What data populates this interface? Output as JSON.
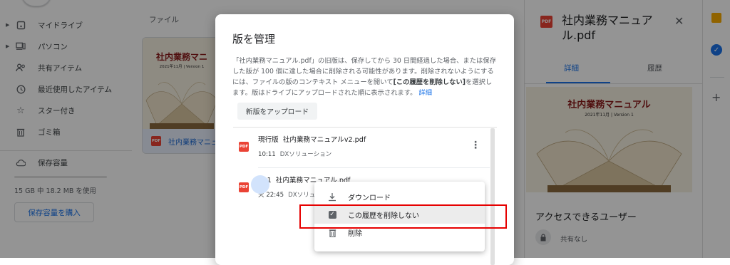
{
  "sidebar": {
    "items": [
      {
        "label": "マイドライブ",
        "icon": "drive-icon",
        "expandable": true
      },
      {
        "label": "パソコン",
        "icon": "computer-icon",
        "expandable": true
      },
      {
        "label": "共有アイテム",
        "icon": "shared-icon",
        "expandable": false
      },
      {
        "label": "最近使用したアイテム",
        "icon": "clock-icon",
        "expandable": false
      },
      {
        "label": "スター付き",
        "icon": "star-icon",
        "expandable": false
      },
      {
        "label": "ゴミ箱",
        "icon": "trash-icon",
        "expandable": false
      }
    ],
    "storage_label": "保存容量",
    "storage_usage": "15 GB 中 18.2 MB を使用",
    "buy_storage": "保存容量を購入"
  },
  "main": {
    "column_header": "ファイル",
    "file_name": "社内業務マニュ",
    "thumb_title": "社内業務マニ",
    "thumb_sub": "2021年11月 | Version 1"
  },
  "details_panel": {
    "title": "社内業務マニュアル.pdf",
    "tabs": [
      "詳細",
      "履歴"
    ],
    "thumb_title": "社内業務マニュアル",
    "thumb_sub": "2021年11月 | Version 1",
    "access_title": "アクセスできるユーザー",
    "access_status": "共有なし"
  },
  "dialog": {
    "title": "版を管理",
    "desc_1": "「社内業務マニュアル.pdf」の旧版は、保存してから 30 日間経過した場合、または保存した版が 100 個に達した場合に削除される可能性があります。削除されないようにするには、ファイルの版のコンテキスト メニューを開いて",
    "desc_bold": "[この履歴を削除しない]",
    "desc_2": "を選択します。版はドライブにアップロードされた順に表示されます。",
    "desc_link": "詳細",
    "upload_button": "新版をアップロード",
    "versions": [
      {
        "tag": "現行版",
        "name": "社内業務マニュアルv2.pdf",
        "time": "10:11",
        "owner": "DXソリューション"
      },
      {
        "tag": "版 1",
        "name": "社内業務マニュアル.pdf",
        "time": "火 22:45",
        "owner": "DXソリュー"
      }
    ]
  },
  "context_menu": {
    "items": [
      {
        "label": "ダウンロード",
        "icon": "download-icon"
      },
      {
        "label": "この履歴を削除しない",
        "icon": "checkbox-checked-icon",
        "highlighted": true
      },
      {
        "label": "削除",
        "icon": "trash-icon"
      }
    ]
  },
  "colors": {
    "accent": "#1a73e8",
    "pdf_red": "#ea4335",
    "annotation_red": "#e60000"
  }
}
